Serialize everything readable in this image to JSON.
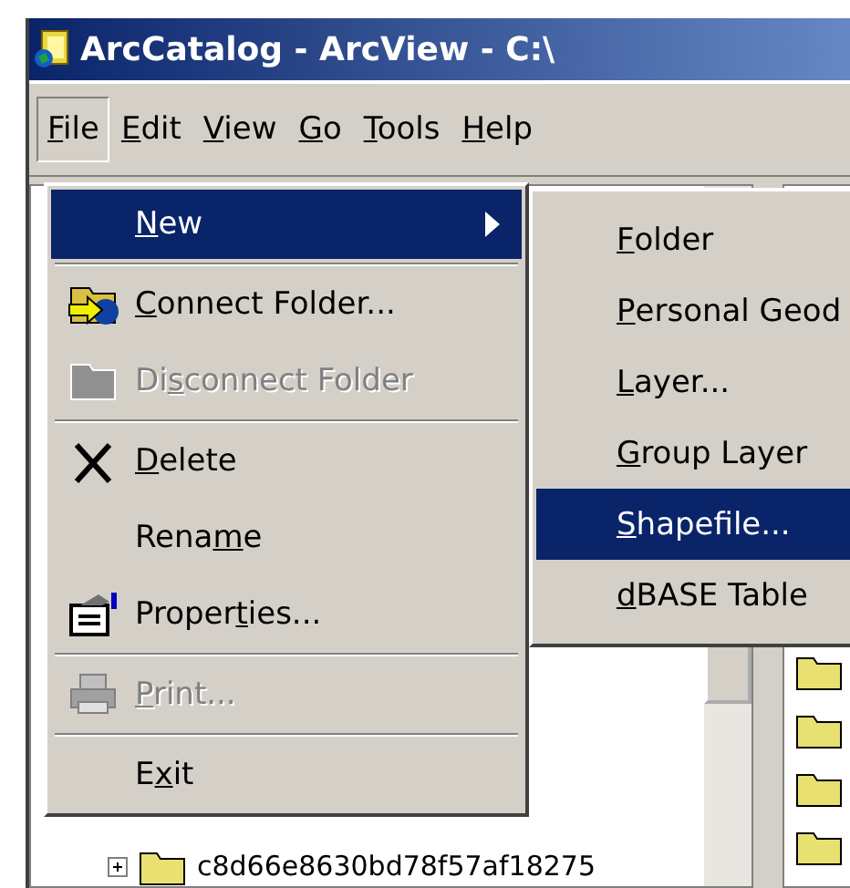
{
  "window": {
    "title": "ArcCatalog - ArcView - C:\\"
  },
  "menu_bar": [
    {
      "access_key": "F",
      "text_after": "ile",
      "selected": true
    },
    {
      "access_key": "E",
      "text_after": "dit",
      "selected": false
    },
    {
      "access_key": "V",
      "text_after": "iew",
      "selected": false
    },
    {
      "access_key": "G",
      "text_after": "o",
      "selected": false
    },
    {
      "access_key": "T",
      "text_after": "ools",
      "selected": false
    },
    {
      "access_key": "H",
      "text_after": "elp",
      "selected": false
    }
  ],
  "file_menu": [
    {
      "kind": "submenu",
      "access_key": "N",
      "text_after": "ew",
      "selected": true,
      "disabled": false
    },
    {
      "kind": "separator"
    },
    {
      "kind": "item",
      "access_key": "C",
      "text_after": "onnect Folder...",
      "selected": false,
      "disabled": false
    },
    {
      "kind": "item",
      "text_before": "Di",
      "access_key": "s",
      "text_after": "connect Folder",
      "selected": false,
      "disabled": true
    },
    {
      "kind": "separator"
    },
    {
      "kind": "item",
      "access_key": "D",
      "text_after": "elete",
      "selected": false,
      "disabled": false
    },
    {
      "kind": "item",
      "text_before": "Rena",
      "access_key": "m",
      "text_after": "e",
      "selected": false,
      "disabled": false
    },
    {
      "kind": "item",
      "text_before": "Proper",
      "access_key": "t",
      "text_after": "ies...",
      "selected": false,
      "disabled": false
    },
    {
      "kind": "separator"
    },
    {
      "kind": "item",
      "access_key": "P",
      "text_after": "rint...",
      "selected": false,
      "disabled": true
    },
    {
      "kind": "separator"
    },
    {
      "kind": "item",
      "text_before": "E",
      "access_key": "x",
      "text_after": "it",
      "selected": false,
      "disabled": false
    }
  ],
  "new_submenu": [
    {
      "access_key": "F",
      "text_after": "older",
      "selected": false
    },
    {
      "access_key": "P",
      "text_after": "ersonal Geod",
      "selected": false
    },
    {
      "access_key": "L",
      "text_after": "ayer...",
      "selected": false
    },
    {
      "access_key": "G",
      "text_after": "roup Layer",
      "selected": false
    },
    {
      "access_key": "S",
      "text_after": "hapefile...",
      "selected": true
    },
    {
      "access_key": "d",
      "text_after": "BASE Table",
      "selected": false
    }
  ],
  "tree": [
    {
      "label": "c8d66e8630bd78f57af18275",
      "expanded": false
    }
  ]
}
